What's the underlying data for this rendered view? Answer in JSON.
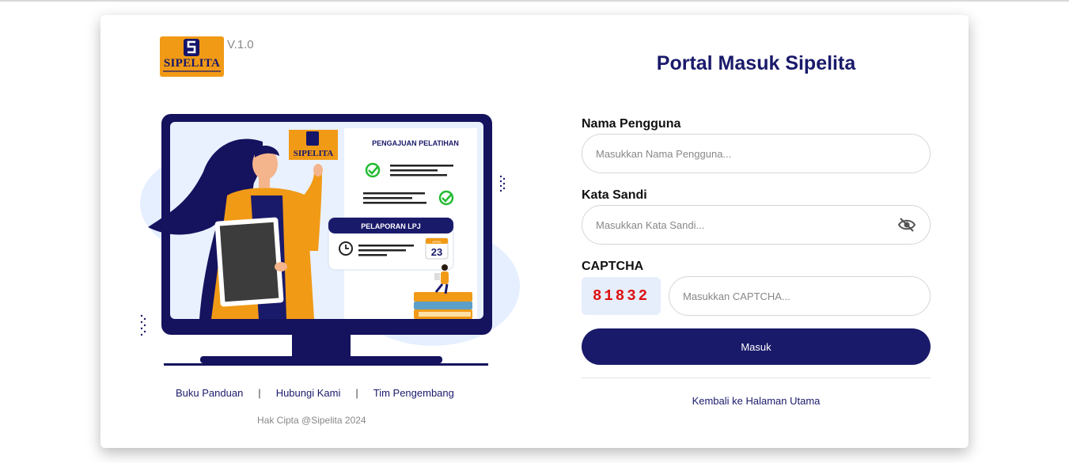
{
  "brand": {
    "name": "SIPELITA",
    "version": "V.1.0",
    "orange": "#f19a16",
    "navy": "#1a1a6b"
  },
  "illustration": {
    "screen_logo": "SIPELITA",
    "card1_title": "PENGAJUAN PELATIHAN",
    "card2_title": "PELAPORAN LPJ",
    "calendar_month": "APRIL",
    "calendar_day": "23"
  },
  "footer": {
    "links": [
      "Buku Panduan",
      "Hubungi Kami",
      "Tim Pengembang"
    ],
    "separator": "|",
    "copyright": "Hak Cipta @Sipelita 2024"
  },
  "form": {
    "title": "Portal Masuk Sipelita",
    "username": {
      "label": "Nama Pengguna",
      "placeholder": "Masukkan Nama Pengguna...",
      "value": ""
    },
    "password": {
      "label": "Kata Sandi",
      "placeholder": "Masukkan Kata Sandi...",
      "value": "",
      "toggle_icon": "eye-off-icon"
    },
    "captcha": {
      "label": "CAPTCHA",
      "code": "81832",
      "placeholder": "Masukkan CAPTCHA...",
      "value": ""
    },
    "submit_label": "Masuk",
    "back_link": "Kembali ke Halaman Utama"
  }
}
